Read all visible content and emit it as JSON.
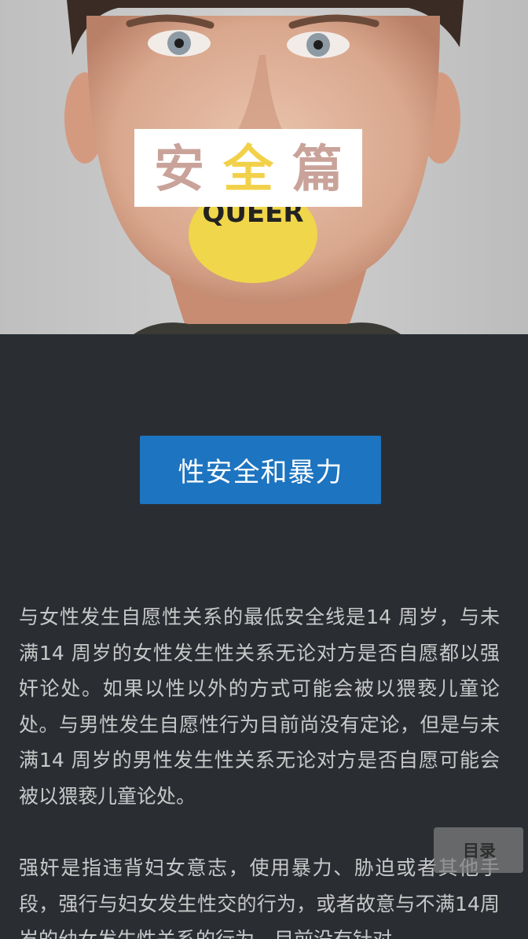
{
  "hero": {
    "title_chars": [
      "安",
      "全",
      "篇"
    ],
    "sticker_text": "QUEER"
  },
  "section": {
    "button_label": "性安全和暴力"
  },
  "article": {
    "paragraphs": [
      "与女性发生自愿性关系的最低安全线是14 周岁，与未满14 周岁的女性发生性关系无论对方是否自愿都以强奸论处。如果以性以外的方式可能会被以猥亵儿童论处。与男性发生自愿性行为目前尚没有定论，但是与未满14 周岁的男性发生性关系无论对方是否自愿可能会被以猥亵儿童论处。",
      "强奸是指违背妇女意志，使用暴力、胁迫或者其他手段，强行与妇女发生性交的行为，或者故意与不满14周岁的幼女发生性关系的行为。目前没有针对"
    ]
  },
  "toc": {
    "label": "目录"
  },
  "colors": {
    "page_background": "#2a2e33",
    "accent_button": "#1d74c0",
    "body_text": "#c8c8c8",
    "sticker_yellow": "#f0d64a"
  }
}
